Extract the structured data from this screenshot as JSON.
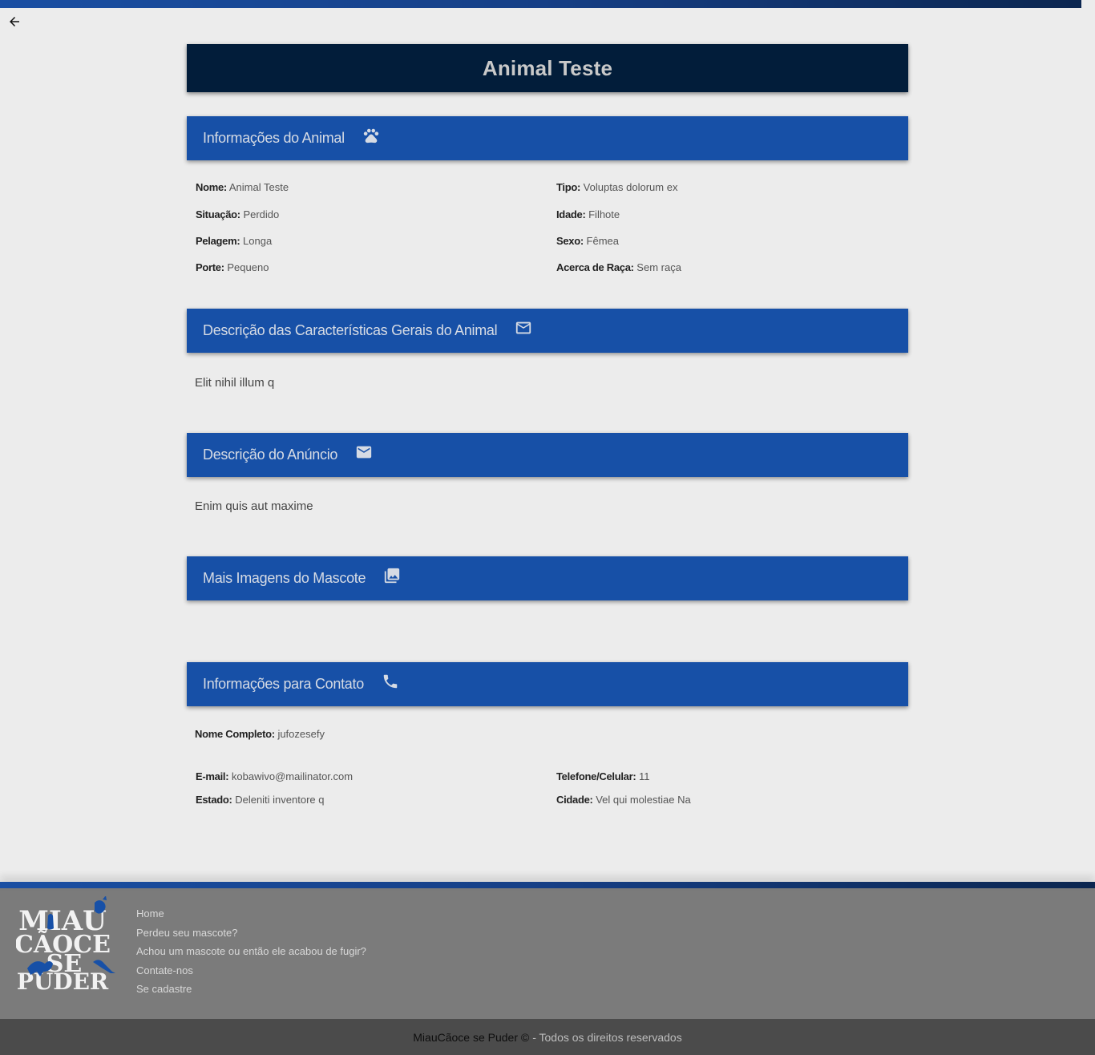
{
  "nav": {
    "back_icon": "arrow-left-icon"
  },
  "page_title": "Animal Teste",
  "sections": {
    "info": {
      "title": "Informações do Animal",
      "icon": "paw-icon"
    },
    "characteristics": {
      "title": "Descrição das Características Gerais do Animal",
      "icon": "mail-outline-icon",
      "text": "Elit nihil illum q"
    },
    "ad": {
      "title": "Descrição do Anúncio",
      "icon": "mail-filled-icon",
      "text": "Enim quis aut maxime"
    },
    "images": {
      "title": "Mais Imagens do Mascote",
      "icon": "photo-library-icon"
    },
    "contact": {
      "title": "Informações para Contato",
      "icon": "phone-icon"
    }
  },
  "animal": {
    "name": {
      "label": "Nome:",
      "value": "Animal Teste"
    },
    "type": {
      "label": "Tipo:",
      "value": "Voluptas dolorum ex"
    },
    "situation": {
      "label": "Situação:",
      "value": "Perdido"
    },
    "age": {
      "label": "Idade:",
      "value": "Filhote"
    },
    "coat": {
      "label": "Pelagem:",
      "value": "Longa"
    },
    "sex": {
      "label": "Sexo:",
      "value": "Fêmea"
    },
    "size": {
      "label": "Porte:",
      "value": "Pequeno"
    },
    "breed": {
      "label": "Acerca de Raça:",
      "value": "Sem raça"
    }
  },
  "contact": {
    "full_name": {
      "label": "Nome Completo:",
      "value": "jufozesefy"
    },
    "email": {
      "label": "E-mail:",
      "value": "kobawivo@mailinator.com"
    },
    "phone": {
      "label": "Telefone/Celular:",
      "value": "11"
    },
    "state": {
      "label": "Estado:",
      "value": "Deleniti inventore q"
    },
    "city": {
      "label": "Cidade:",
      "value": "Vel qui molestiae Na"
    }
  },
  "footer": {
    "logo_text": [
      "MIAU",
      "CÃOCE",
      "SE",
      "PUDER"
    ],
    "links": [
      "Home",
      "Perdeu seu mascote?",
      "Achou um mascote ou então ele acabou de fugir?",
      "Contate-nos",
      "Se cadastre"
    ],
    "copyright_brand": "MiauCãoce se Puder ©",
    "copyright_text": "- Todos os direitos reservados"
  },
  "colors": {
    "header_blue": "#1750a7",
    "title_navy": "#021d3a",
    "footer_gray": "#7b7b7b",
    "copyright_gray": "#4b4b4b"
  }
}
